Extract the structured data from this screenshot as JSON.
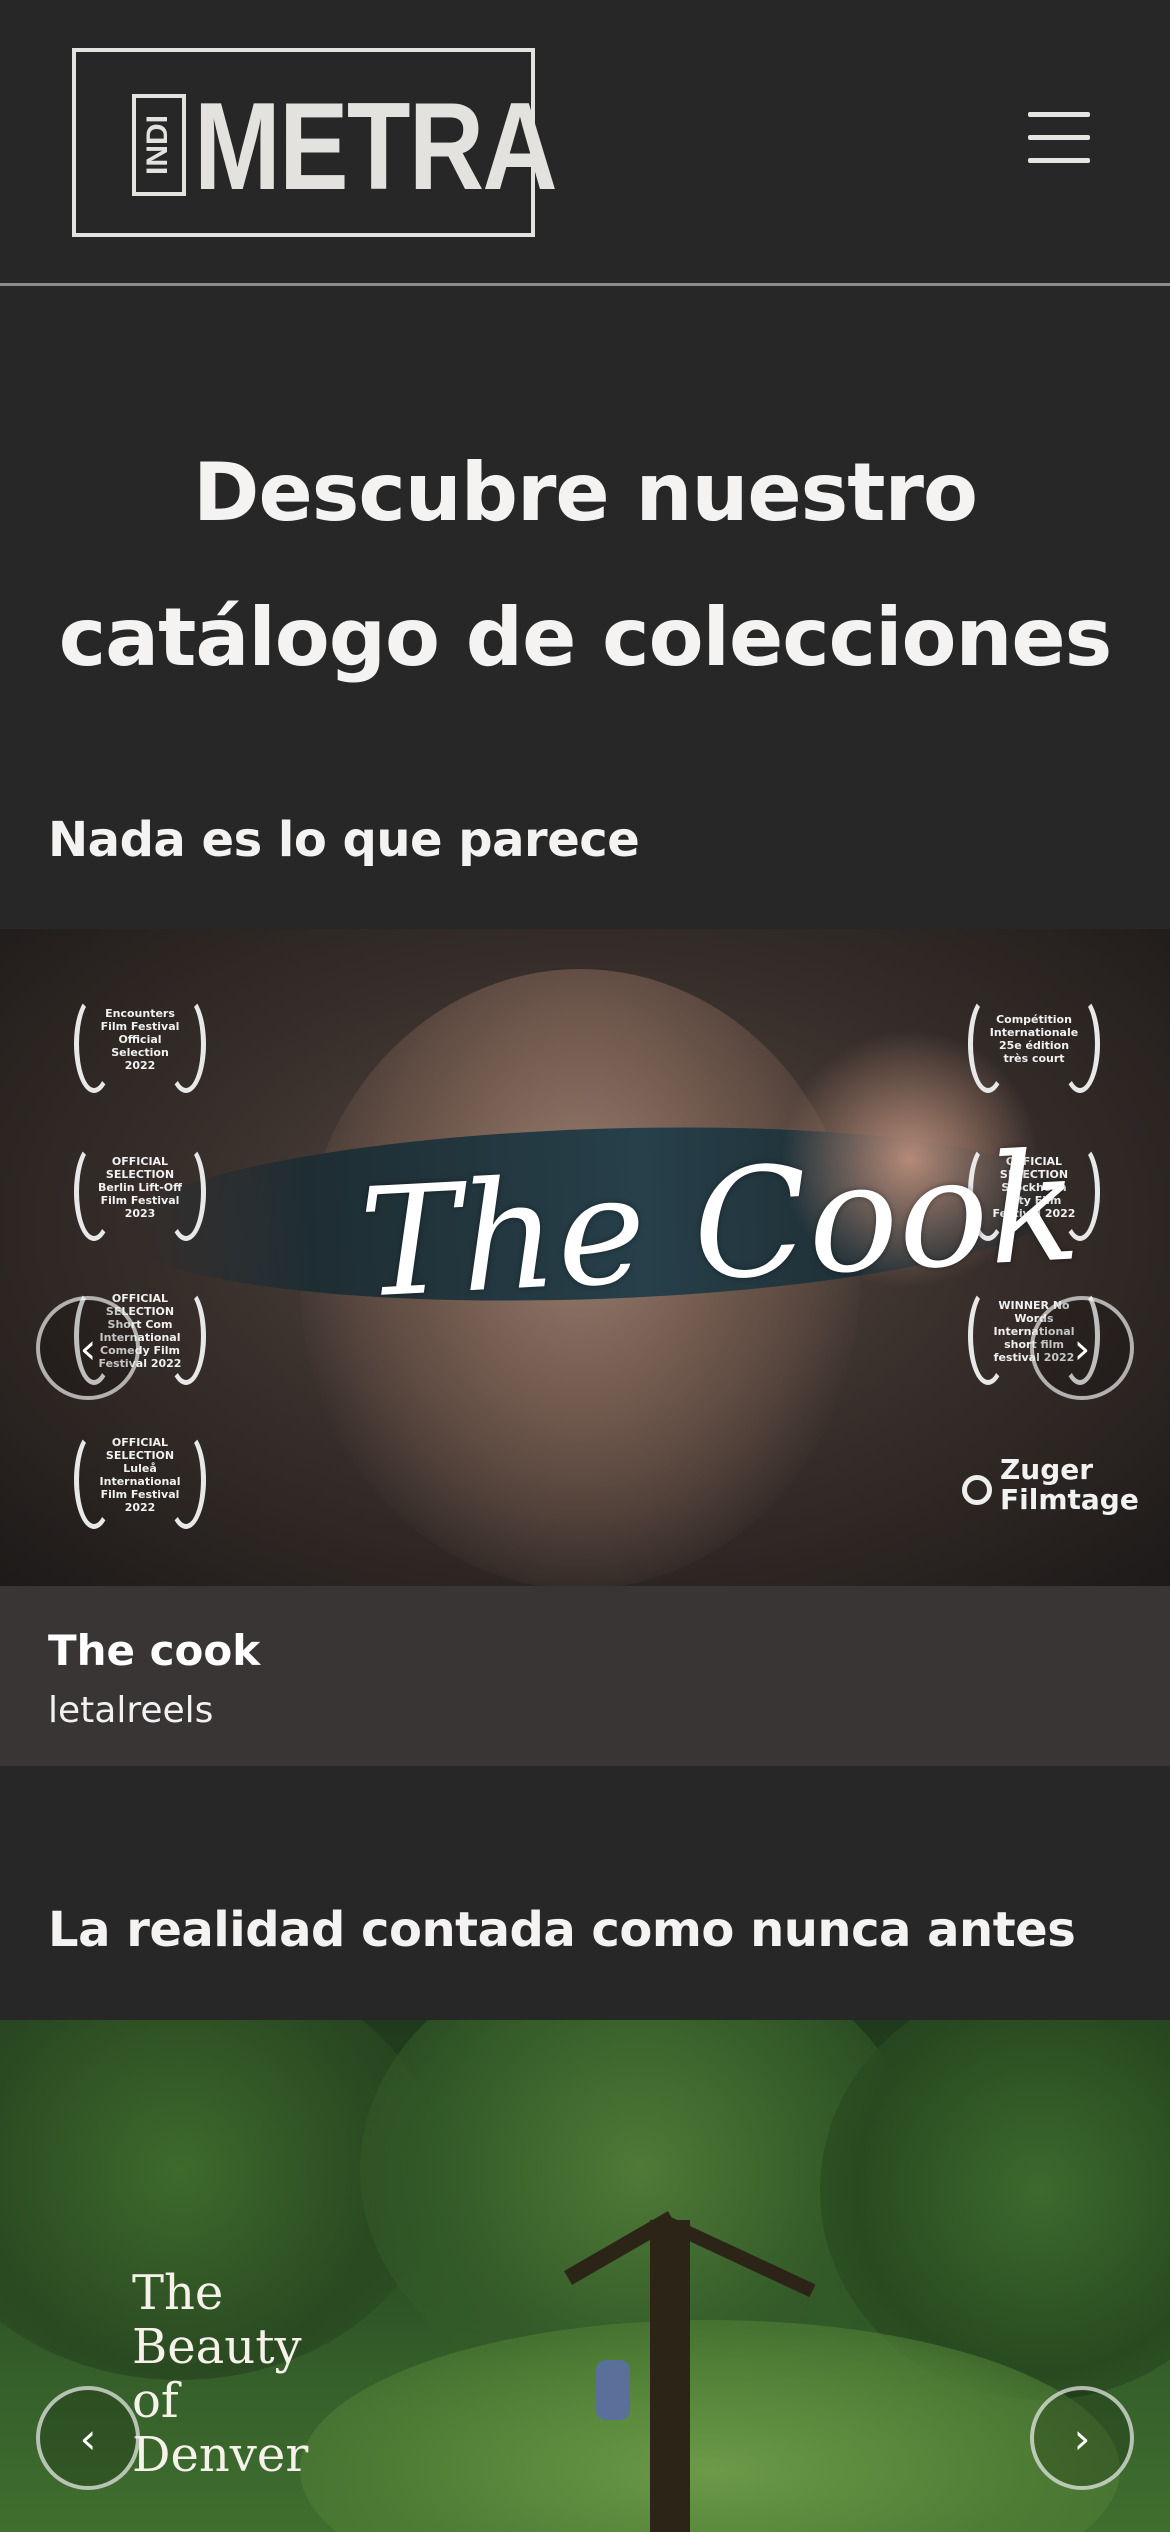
{
  "header": {
    "logo_prefix": "INDI",
    "logo_text": "METRA",
    "menu_icon": "hamburger-menu-icon"
  },
  "main": {
    "title": "Descubre nuestro catálogo de colecciones"
  },
  "collections": [
    {
      "title": "Nada es lo que parece",
      "poster_title": "The Cook",
      "laurels_left": [
        "Encounters Film Festival Official Selection 2022",
        "OFFICIAL SELECTION Berlin Lift-Off Film Festival 2023",
        "OFFICIAL SELECTION Short Com International Comedy Film Festival 2022",
        "OFFICIAL SELECTION Luleå International Film Festival 2022"
      ],
      "laurels_right": [
        "Compétition Internationale 25e édition très court",
        "OFFICIAL SELECTION Stockholm City Film Festival 2022",
        "WINNER No Words International short film festival 2022"
      ],
      "sponsor": "Zuger Filmtage",
      "item_title": "The cook",
      "item_author": "letalreels"
    },
    {
      "title": "La realidad contada como nunca antes",
      "poster_title": "The Beauty of Denver"
    }
  ],
  "controls": {
    "prev_arrow": "‹",
    "next_arrow": "›"
  },
  "colors": {
    "background": "#282728",
    "caption_bg": "#393534",
    "logo": "#e4e2de",
    "divider": "#8d8c8c"
  }
}
